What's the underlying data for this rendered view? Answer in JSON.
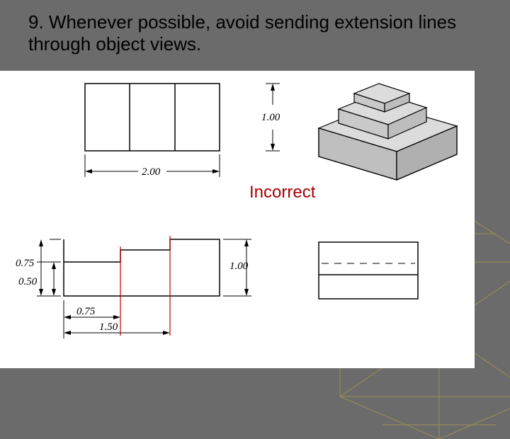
{
  "heading": "9. Whenever possible, avoid sending extension lines through object views.",
  "label_incorrect": "Incorrect",
  "dimensions": {
    "upper_height": "1.00",
    "upper_width": "2.00",
    "lower_height": "1.00",
    "step1_h": "0.75",
    "step2_h": "0.50",
    "step_w1": "0.75",
    "step_w2": "1.50"
  }
}
